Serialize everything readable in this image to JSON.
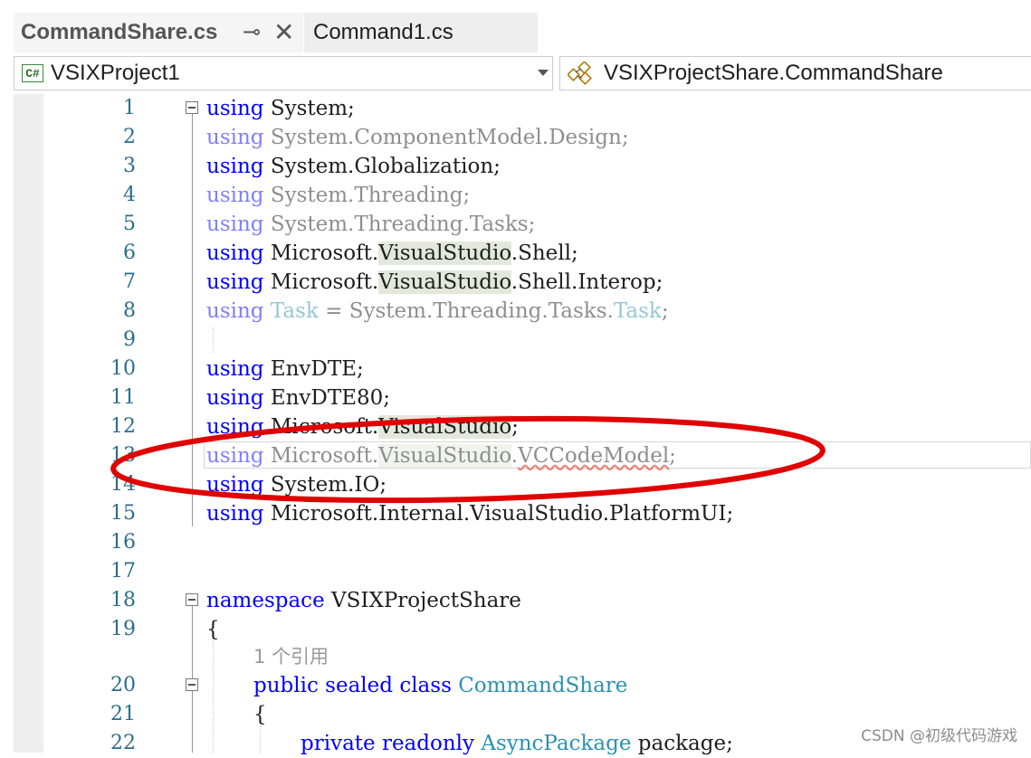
{
  "tabs": {
    "active": {
      "label": "CommandShare.cs"
    },
    "inactive": {
      "label": "Command1.cs"
    }
  },
  "icons": {
    "pin": "pin-icon",
    "close": "close-icon",
    "dropdown": "chevron-down-icon",
    "csharp_project": "csharp-project-icon",
    "class": "class-icon"
  },
  "navbar": {
    "project_dropdown": "VSIXProject1",
    "type_dropdown": "VSIXProjectShare.CommandShare",
    "cs_icon_text": "C#"
  },
  "editor": {
    "lines": [
      {
        "n": "1"
      },
      {
        "n": "2"
      },
      {
        "n": "3"
      },
      {
        "n": "4"
      },
      {
        "n": "5"
      },
      {
        "n": "6"
      },
      {
        "n": "7"
      },
      {
        "n": "8"
      },
      {
        "n": "9"
      },
      {
        "n": "10"
      },
      {
        "n": "11"
      },
      {
        "n": "12"
      },
      {
        "n": "13"
      },
      {
        "n": "14"
      },
      {
        "n": "15"
      },
      {
        "n": "16"
      },
      {
        "n": "17"
      },
      {
        "n": "18"
      },
      {
        "n": "19"
      },
      {
        "n": "20"
      },
      {
        "n": "21"
      },
      {
        "n": "22"
      }
    ],
    "t": {
      "using": "using",
      "System": "System",
      "semi": ";",
      "dot": ".",
      "ComponentModel": "ComponentModel",
      "Design": "Design",
      "Globalization": "Globalization",
      "Threading": "Threading",
      "Tasks": "Tasks",
      "Microsoft": "Microsoft",
      "VisualStudio": "VisualStudio",
      "Shell": "Shell",
      "Interop": "Interop",
      "Task": "Task",
      "eq": " = ",
      "EnvDTE": "EnvDTE",
      "EnvDTE80": "EnvDTE80",
      "VCCodeModel": "VCCodeModel",
      "IO": "IO",
      "Internal": "Internal",
      "PlatformUI": "PlatformUI",
      "namespace": "namespace",
      "VSIXProjectShare": "VSIXProjectShare",
      "lbrace": "{",
      "codelens": "1 个引用",
      "public": "public",
      "sealed": "sealed",
      "class": "class",
      "CommandShare": "CommandShare",
      "private": "private",
      "readonly": "readonly",
      "AsyncPackage": "AsyncPackage",
      "package": "package"
    }
  },
  "annotation": {
    "shape": "ellipse",
    "color": "#e00000"
  },
  "colors": {
    "keyword": "#0000ff",
    "type": "#2b91af",
    "line_number": "#2b6d8c",
    "error_squiggle": "#e51400",
    "highlight": "#e4e8dc"
  },
  "watermark": "CSDN @初级代码游戏"
}
